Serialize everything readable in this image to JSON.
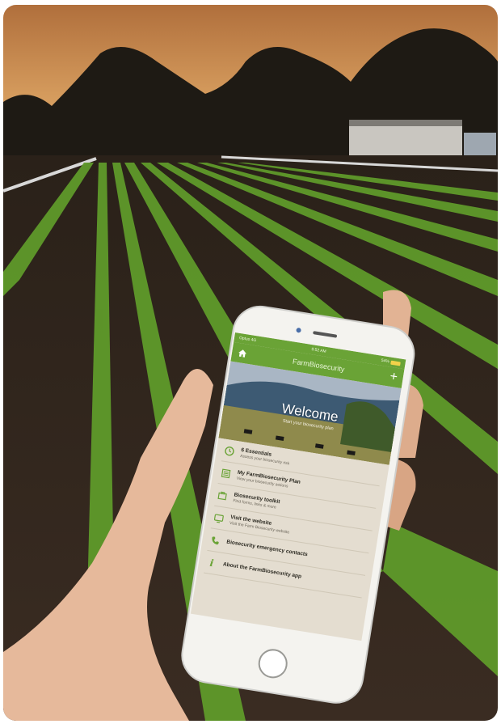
{
  "app": {
    "status_bar": {
      "carrier": "Optus 4G",
      "time": "9:52 AM",
      "battery": "54%"
    },
    "title": "FarmBiosecurity",
    "hero": {
      "title": "Welcome",
      "subtitle": "Start your biosecurity plan"
    },
    "menu": [
      {
        "icon": "clock-icon",
        "label": "6 Essentials",
        "sub": "Assess your biosecurity risk"
      },
      {
        "icon": "checklist-icon",
        "label": "My FarmBiosecurity Plan",
        "sub": "View your biosecurity actions"
      },
      {
        "icon": "toolkit-icon",
        "label": "Biosecurity toolkit",
        "sub": "Find forms, links & more"
      },
      {
        "icon": "monitor-icon",
        "label": "Visit the website",
        "sub": "Visit the Farm Biosecurity website"
      },
      {
        "icon": "phone-icon",
        "label": "Biosecurity emergency contacts",
        "sub": ""
      },
      {
        "icon": "info-icon",
        "label": "About the FarmBiosecurity app",
        "sub": ""
      }
    ],
    "accent_color": "#6aa336"
  }
}
